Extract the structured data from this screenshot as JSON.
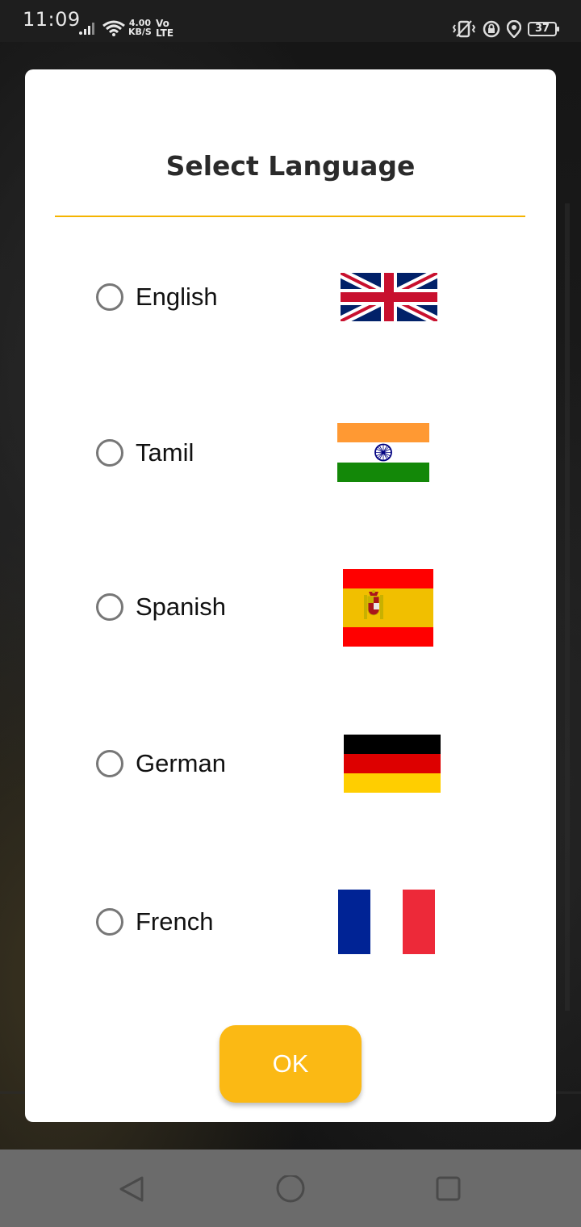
{
  "status_bar": {
    "time": "11:09",
    "speed_value": "4.00",
    "speed_unit": "KB/S",
    "volte_top": "Vo",
    "volte_bottom": "LTE",
    "battery": "37"
  },
  "dialog": {
    "title": "Select Language",
    "accent_color": "#f5b400",
    "options": [
      {
        "label": "English",
        "flag": "uk-flag-icon",
        "selected": false
      },
      {
        "label": "Tamil",
        "flag": "india-flag-icon",
        "selected": false
      },
      {
        "label": "Spanish",
        "flag": "spain-flag-icon",
        "selected": false
      },
      {
        "label": "German",
        "flag": "germany-flag-icon",
        "selected": false
      },
      {
        "label": "French",
        "flag": "france-flag-icon",
        "selected": false
      }
    ],
    "ok_label": "OK",
    "ok_color": "#fbb914"
  },
  "nav_bar": {
    "icons": [
      "back-icon",
      "home-icon",
      "recents-icon"
    ]
  }
}
